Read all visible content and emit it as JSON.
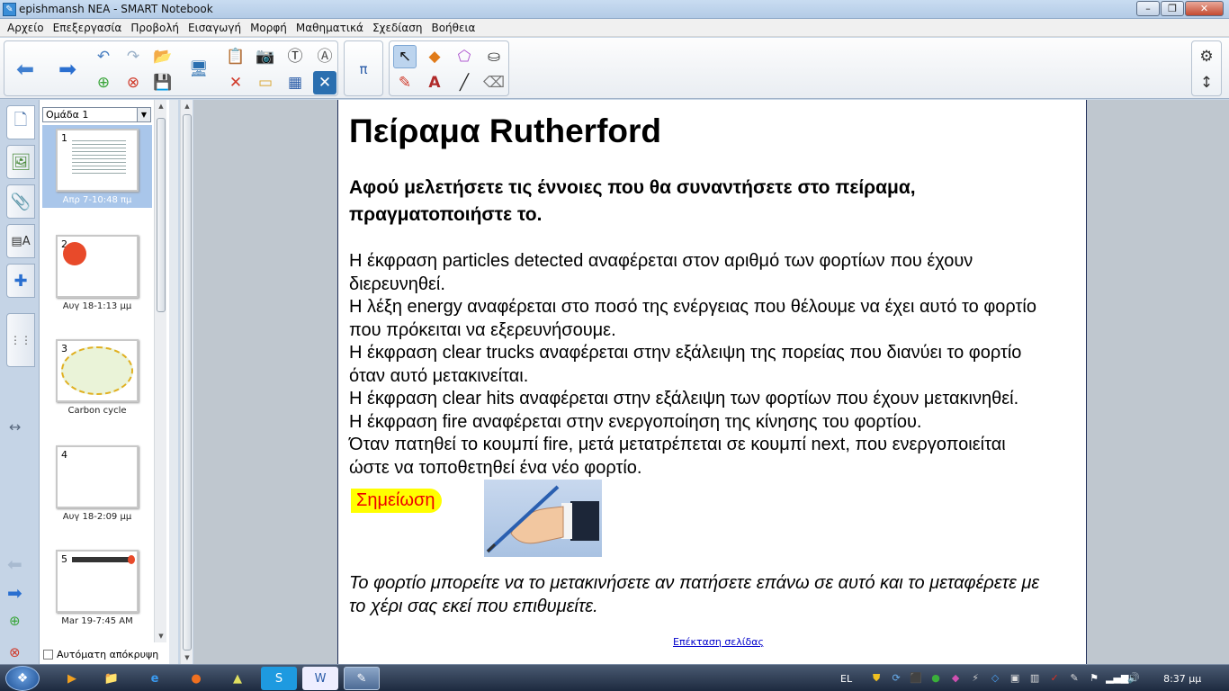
{
  "window": {
    "title": "epishmansh NEA - SMART Notebook"
  },
  "menu": [
    "Αρχείο",
    "Επεξεργασία",
    "Προβολή",
    "Εισαγωγή",
    "Μορφή",
    "Μαθηματικά",
    "Σχεδίαση",
    "Βοήθεια"
  ],
  "sorter": {
    "group": "Ομάδα 1",
    "pages": [
      {
        "num": "1",
        "label": "Απρ 7-10:48 πμ"
      },
      {
        "num": "2",
        "label": "Αυγ 18-1:13 μμ"
      },
      {
        "num": "3",
        "label": "Carbon cycle"
      },
      {
        "num": "4",
        "label": "Αυγ 18-2:09 μμ"
      },
      {
        "num": "5",
        "label": "Mar 19-7:45 AM"
      }
    ],
    "autohide": "Αυτόματη απόκρυψη"
  },
  "page": {
    "title": "Πείραμα Rutherford",
    "subtitle": "Αφού μελετήσετε τις έννοιες που θα συναντήσετε στο πείραμα, πραγματοποιήστε το.",
    "lines": [
      "Η έκφραση particles detected αναφέρεται στον αριθμό των φορτίων που έχουν",
      "διερευνηθεί.",
      "Η λέξη energy αναφέρεται στο ποσό της ενέργειας που θέλουμε να έχει αυτό το φορτίο",
      "που πρόκειται να εξερευνήσουμε.",
      "Η έκφραση clear trucks αναφέρεται στην εξάλειψη της πορείας που διανύει το φορτίο",
      "όταν αυτό μετακινείται.",
      "Η έκφραση clear hits αναφέρεται στην εξάλειψη των φορτίων που έχουν μετακινηθεί.",
      "Η έκφραση fire αναφέρεται στην ενεργοποίηση της κίνησης του φορτίου.",
      "Όταν πατηθεί το κουμπί fire, μετά μετατρέπεται σε κουμπί next, που ενεργοποιείται",
      "ώστε να τοποθετηθεί ένα νέο φορτίο."
    ],
    "note": "Σημείωση",
    "italic_lines": [
      "Το φορτίο μπορείτε να το μετακινήσετε αν πατήσετε επάνω σε αυτό και το μεταφέρετε με",
      "το χέρι σας εκεί που επιθυμείτε."
    ],
    "extend": "Επέκταση σελίδας"
  },
  "taskbar": {
    "lang": "EL",
    "time": "8:37 μμ"
  },
  "icons": {
    "back": "back-arrow-icon",
    "forward": "forward-arrow-icon",
    "undo": "undo-icon",
    "redo": "redo-icon",
    "open": "open-folder-icon",
    "add_page": "add-page-icon",
    "delete_page": "delete-page-icon",
    "save": "save-icon",
    "screen": "screen-display-icon",
    "paste": "paste-icon",
    "capture": "screen-capture-icon",
    "shade": "screen-shade-icon",
    "table": "table-icon",
    "math": "math-pi-icon",
    "select": "select-pointer-icon",
    "shapes": "shapes-icon",
    "eraser": "eraser-icon",
    "fill": "fill-icon",
    "pens": "pens-icon",
    "text": "text-icon",
    "line": "line-icon",
    "settings": "gear-icon",
    "move_toolbar": "move-toolbar-icon"
  },
  "colors": {
    "accent": "#3a7bd5",
    "note_bg": "#ffff00",
    "note_text": "#ee0000",
    "link": "#0000cc"
  }
}
